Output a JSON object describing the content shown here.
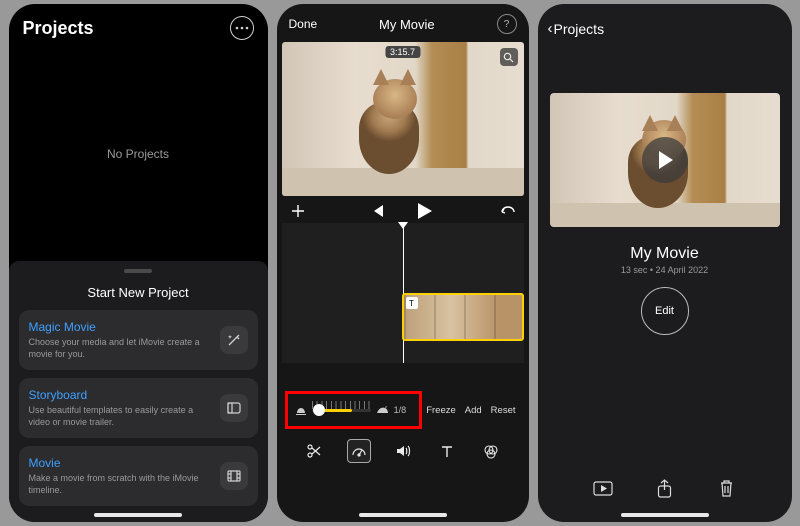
{
  "panel1": {
    "title": "Projects",
    "more_icon": "ellipsis-icon",
    "empty_label": "No Projects",
    "start_label": "Start New Project",
    "items": [
      {
        "title": "Magic Movie",
        "desc": "Choose your media and let iMovie create a movie for you.",
        "icon": "wand-icon"
      },
      {
        "title": "Storyboard",
        "desc": "Use beautiful templates to easily create a video or movie trailer.",
        "icon": "storyboard-icon"
      },
      {
        "title": "Movie",
        "desc": "Make a movie from scratch with the iMovie timeline.",
        "icon": "film-icon"
      }
    ]
  },
  "panel2": {
    "done_label": "Done",
    "title": "My Movie",
    "help_icon": "help-icon",
    "preview_time": "3:15.7",
    "zoom_icon": "magnify-icon",
    "transport": {
      "add_icon": "plus-icon",
      "prev_icon": "skip-back-icon",
      "play_icon": "play-icon",
      "undo_icon": "undo-icon"
    },
    "clip_badge": "T",
    "speed": {
      "slow_icon": "tortoise-icon",
      "fast_icon": "hare-icon",
      "rate_label": "1/8"
    },
    "speed_actions": {
      "freeze": "Freeze",
      "add": "Add",
      "reset": "Reset"
    },
    "tools": {
      "scissors": "scissors-icon",
      "speed": "speedometer-icon",
      "volume": "volume-icon",
      "text": "text-icon",
      "filter": "filter-icon"
    }
  },
  "panel3": {
    "back_label": "Projects",
    "movie_title": "My Movie",
    "movie_meta": "13 sec • 24 April 2022",
    "edit_label": "Edit",
    "actions": {
      "play": "play-rect-icon",
      "share": "share-icon",
      "delete": "trash-icon"
    }
  }
}
